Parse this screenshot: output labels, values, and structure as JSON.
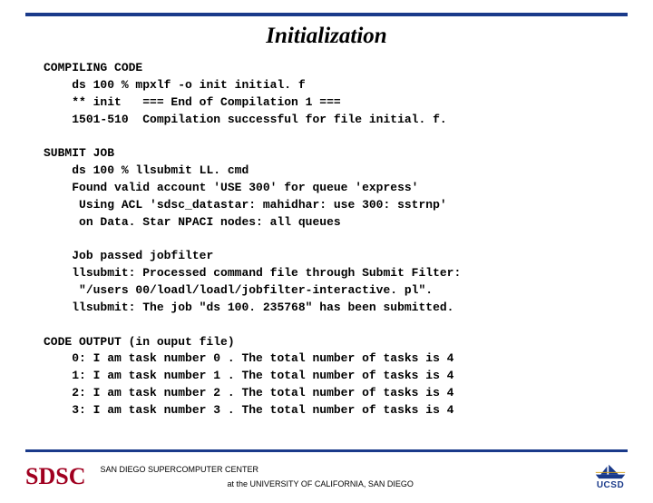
{
  "title": "Initialization",
  "sections": {
    "compiling_header": "COMPILING CODE",
    "compiling_lines": [
      "ds 100 % mpxlf -o init initial. f",
      "** init   === End of Compilation 1 ===",
      "1501-510  Compilation successful for file initial. f."
    ],
    "submit_header": "SUBMIT JOB",
    "submit_lines": [
      "ds 100 % llsubmit LL. cmd",
      "Found valid account 'USE 300' for queue 'express'",
      " Using ACL 'sdsc_datastar: mahidhar: use 300: sstrnp'",
      " on Data. Star NPACI nodes: all queues"
    ],
    "job_lines": [
      "Job passed jobfilter",
      "llsubmit: Processed command file through Submit Filter:",
      " \"/users 00/loadl/loadl/jobfilter-interactive. pl\".",
      "llsubmit: The job \"ds 100. 235768\" has been submitted."
    ],
    "output_header": "CODE OUTPUT (in ouput file)",
    "output_lines": [
      "0: I am task number 0 . The total number of tasks is 4",
      "1: I am task number 1 . The total number of tasks is 4",
      "2: I am task number 2 . The total number of tasks is 4",
      "3: I am task number 3 . The total number of tasks is 4"
    ]
  },
  "footer": {
    "sdsc": "SDSC",
    "line1": "SAN DIEGO SUPERCOMPUTER CENTER",
    "line2": "at the UNIVERSITY OF CALIFORNIA, SAN DIEGO",
    "ucsd": "UCSD"
  }
}
